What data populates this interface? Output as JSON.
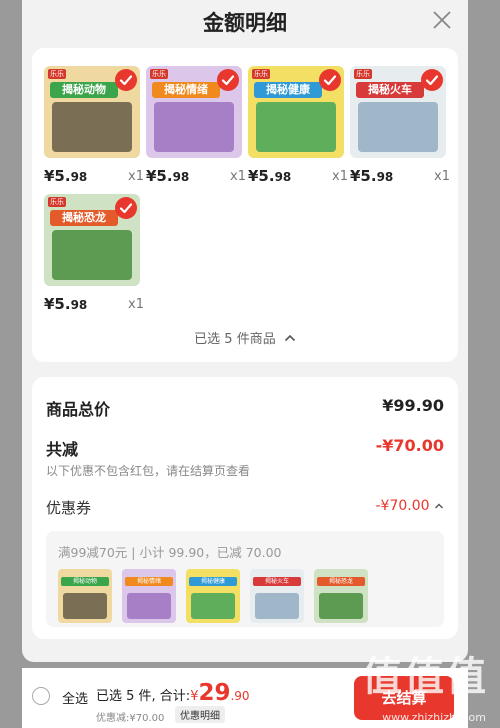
{
  "header": {
    "title": "金额明细"
  },
  "products": [
    {
      "title": "揭秘动物",
      "price_main": "¥5.",
      "price_small": "98",
      "qty": "x1",
      "banner_color": "#3aa54a",
      "scene_color": "#7a6f55",
      "bg": "#efd9a0"
    },
    {
      "title": "揭秘情绪",
      "price_main": "¥5.",
      "price_small": "98",
      "qty": "x1",
      "banner_color": "#f08a1f",
      "scene_color": "#a67fc7",
      "bg": "#dcc6ea"
    },
    {
      "title": "揭秘健康",
      "price_main": "¥5.",
      "price_small": "98",
      "qty": "x1",
      "banner_color": "#2f9ad6",
      "scene_color": "#5fae5c",
      "bg": "#f3df63"
    },
    {
      "title": "揭秘火车",
      "price_main": "¥5.",
      "price_small": "98",
      "qty": "x1",
      "banner_color": "#d83a3a",
      "scene_color": "#9fb7c8",
      "bg": "#e7ecef"
    },
    {
      "title": "揭秘恐龙",
      "price_main": "¥5.",
      "price_small": "98",
      "qty": "x1",
      "banner_color": "#e35b2b",
      "scene_color": "#5d9a52",
      "bg": "#cfe3c4"
    }
  ],
  "selection": {
    "label": "已选 5 件商品"
  },
  "summary": {
    "total_label": "商品总价",
    "total_value": "¥99.90",
    "reduce_label": "共减",
    "reduce_value": "-¥70.00",
    "note": "以下优惠不包含红包，请在结算页查看",
    "coupon_label": "优惠券",
    "coupon_value": "-¥70.00",
    "coupon_desc": "满99减70元 | 小计 99.90，已减 70.00"
  },
  "bottom": {
    "select_all": "全选",
    "selected_total_prefix": "已选 5 件, 合计:",
    "currency": "¥",
    "total_int": "29",
    "total_dec": ".90",
    "discount": "优惠减:¥70.00",
    "detail_button": "优惠明细",
    "checkout": "去结算"
  },
  "watermark": {
    "big": "值值值",
    "small": "www.zhizhizhi.com"
  },
  "colors": {
    "accent": "#e8372c"
  }
}
